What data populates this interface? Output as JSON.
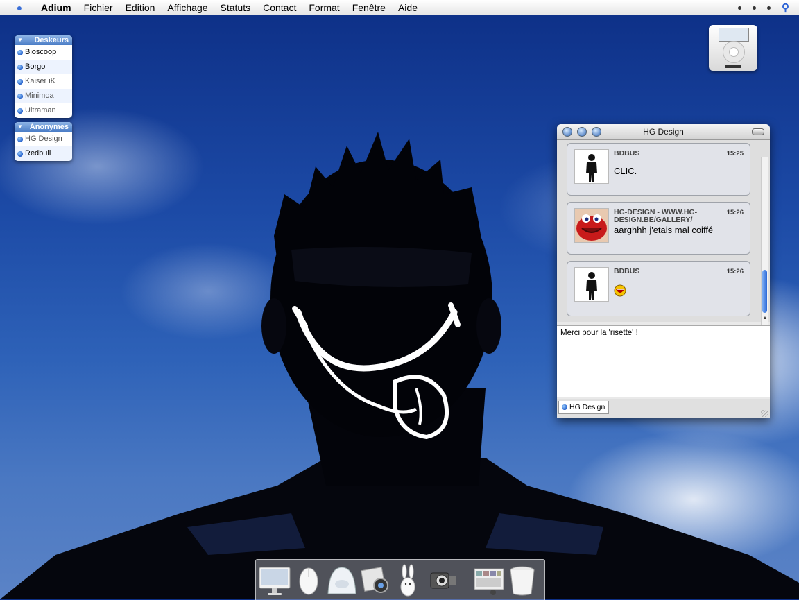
{
  "menubar": {
    "app": "Adium",
    "items": [
      "Fichier",
      "Edition",
      "Affichage",
      "Statuts",
      "Contact",
      "Format",
      "Fenêtre",
      "Aide"
    ]
  },
  "contacts": {
    "groups": [
      {
        "name": "Deskeurs",
        "members": [
          "Bioscoop",
          "Borgo",
          "Kaiser iK",
          "Minimoa",
          "Ultraman"
        ]
      },
      {
        "name": "Anonymes",
        "members": [
          "HG Design",
          "Redbull"
        ]
      }
    ]
  },
  "chat": {
    "title": "HG Design",
    "messages": [
      {
        "sender": "BDBUS",
        "time": "15:25",
        "text": "CLIC."
      },
      {
        "sender": "HG-DESIGN - WWW.HG-DESIGN.BE/GALLERY/",
        "time": "15:26",
        "text": "aarghhh j'etais mal coiffé"
      },
      {
        "sender": "BDBUS",
        "time": "15:26",
        "text": ""
      }
    ],
    "input_text": "Merci pour la 'risette' !",
    "tab_label": "HG Design"
  },
  "dock": {
    "items": [
      "imac-icon",
      "mouse-icon",
      "speaker-icon",
      "iphoto-icon",
      "rabbit-icon",
      "camcorder-icon",
      "panel-icon",
      "trash-icon"
    ]
  },
  "colors": {
    "accent": "#2b68d6",
    "desktop_sky": "#1c4aa6"
  }
}
